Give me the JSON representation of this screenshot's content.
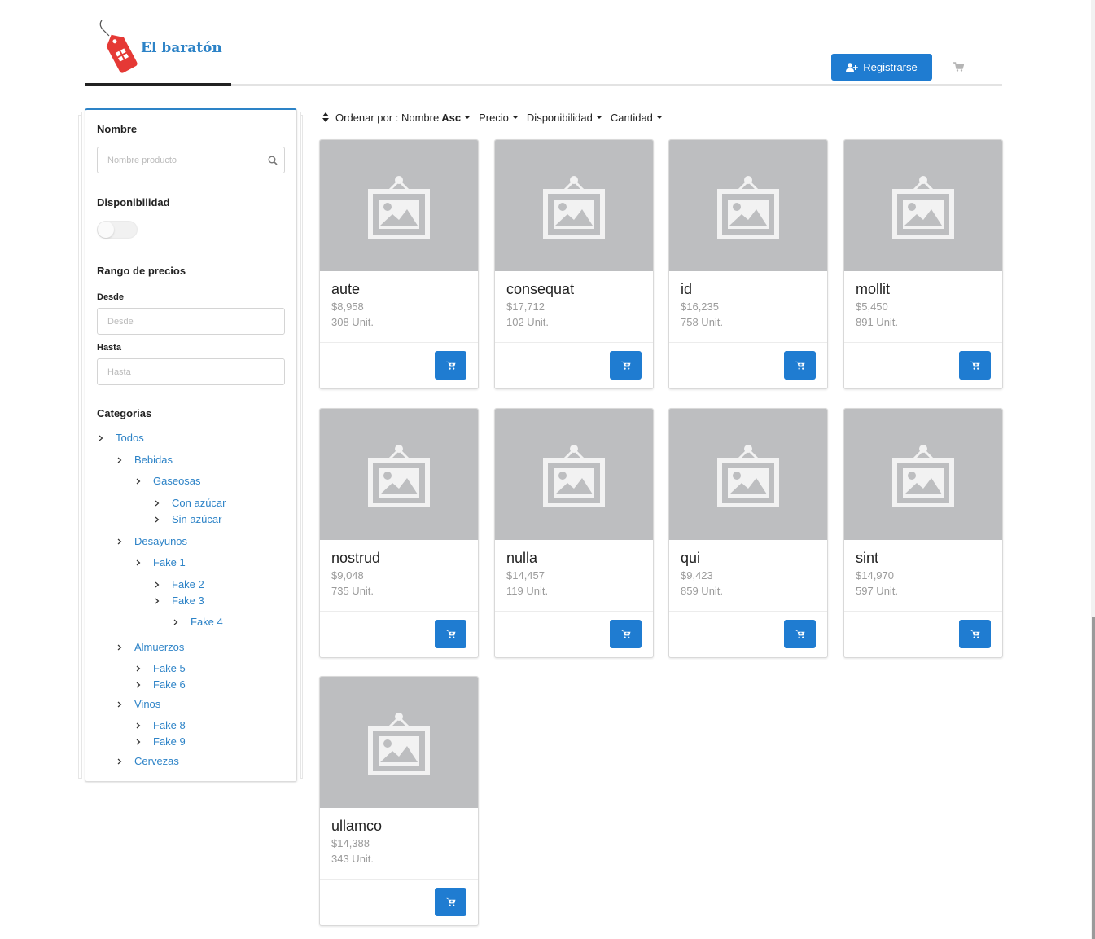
{
  "header": {
    "brand": "El baratón",
    "register_label": "Registrarse",
    "icons": {
      "logo": "price-tag-icon",
      "register": "user-plus-icon",
      "cart": "cart-icon"
    },
    "accent_color": "#1f7cd1"
  },
  "sidebar": {
    "name_title": "Nombre",
    "name_placeholder": "Nombre producto",
    "availability_title": "Disponibilidad",
    "availability_on": false,
    "price_range_title": "Rango de precios",
    "from_label": "Desde",
    "from_placeholder": "Desde",
    "to_label": "Hasta",
    "to_placeholder": "Hasta",
    "categories_title": "Categorias",
    "categories": [
      "Todos",
      "Bebidas",
      "Gaseosas",
      "Con azúcar",
      "Sin azúcar",
      "Desayunos",
      "Fake 1",
      "Fake 2",
      "Fake 3",
      "Fake 4",
      "Almuerzos",
      "Fake 5",
      "Fake 6",
      "Vinos",
      "Fake 8",
      "Fake 9",
      "Cervezas"
    ]
  },
  "sort": {
    "prefix": "Ordenar por :",
    "name": "Nombre",
    "direction": "Asc",
    "price": "Precio",
    "availability": "Disponibilidad",
    "quantity": "Cantidad"
  },
  "products": [
    {
      "name": "aute",
      "price": "$8,958",
      "stock": "308 Unit."
    },
    {
      "name": "consequat",
      "price": "$17,712",
      "stock": "102 Unit."
    },
    {
      "name": "id",
      "price": "$16,235",
      "stock": "758 Unit."
    },
    {
      "name": "mollit",
      "price": "$5,450",
      "stock": "891 Unit."
    },
    {
      "name": "nostrud",
      "price": "$9,048",
      "stock": "735 Unit."
    },
    {
      "name": "nulla",
      "price": "$14,457",
      "stock": "119 Unit."
    },
    {
      "name": "qui",
      "price": "$9,423",
      "stock": "859 Unit."
    },
    {
      "name": "sint",
      "price": "$14,970",
      "stock": "597 Unit."
    },
    {
      "name": "ullamco",
      "price": "$14,388",
      "stock": "343 Unit."
    }
  ]
}
